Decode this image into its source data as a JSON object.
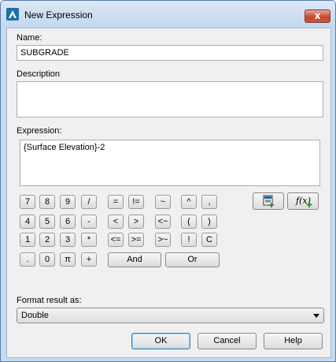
{
  "window": {
    "title": "New Expression",
    "close_glyph": "x"
  },
  "name": {
    "label": "Name:",
    "value": "SUBGRADE"
  },
  "description": {
    "label": "Description",
    "value": ""
  },
  "expression": {
    "label": "Expression:",
    "value": "{Surface Elevation}-2"
  },
  "keypad": {
    "rows": [
      [
        "7",
        "8",
        "9",
        "/"
      ],
      [
        "4",
        "5",
        "6",
        "-"
      ],
      [
        "1",
        "2",
        "3",
        "*"
      ],
      [
        ".",
        "0",
        "π",
        "+"
      ]
    ],
    "ops": [
      [
        "=",
        "!=",
        "~",
        "^",
        ","
      ],
      [
        "<",
        ">",
        "<~",
        "(",
        ")"
      ],
      [
        "<=",
        ">=",
        ">~",
        "!",
        "C"
      ]
    ],
    "and_label": "And",
    "or_label": "Or"
  },
  "tools": {
    "insert_property_icon": "insert-property-icon",
    "insert_function_icon": "insert-function-icon",
    "function_glyph": "f(x)"
  },
  "format": {
    "label": "Format result as:",
    "selected": "Double"
  },
  "buttons": {
    "ok": "OK",
    "cancel": "Cancel",
    "help": "Help"
  },
  "colors": {
    "accent_green": "#2a9a2a",
    "title_blue": "#c4d7ee",
    "close_red": "#c7462c"
  }
}
